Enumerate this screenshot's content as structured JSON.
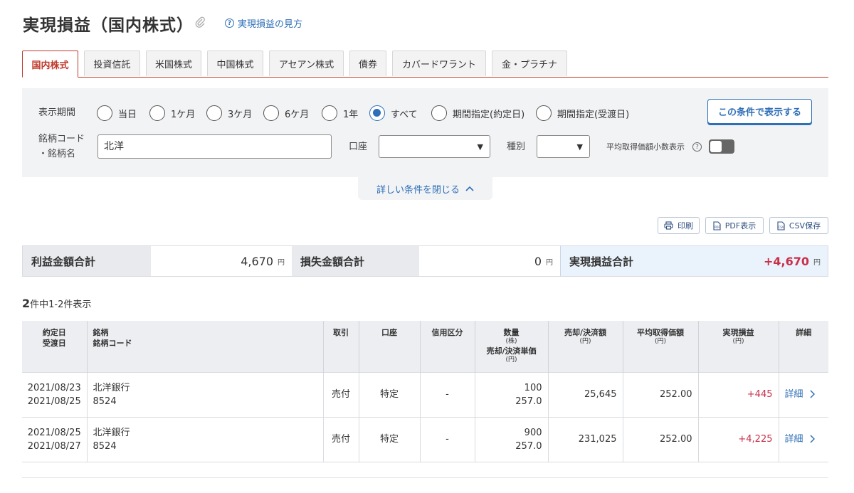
{
  "header": {
    "title": "実現損益（国内株式）",
    "help_link": "実現損益の見方"
  },
  "tabs": [
    {
      "label": "国内株式",
      "active": true
    },
    {
      "label": "投資信託",
      "active": false
    },
    {
      "label": "米国株式",
      "active": false
    },
    {
      "label": "中国株式",
      "active": false
    },
    {
      "label": "アセアン株式",
      "active": false
    },
    {
      "label": "債券",
      "active": false
    },
    {
      "label": "カバードワラント",
      "active": false
    },
    {
      "label": "金・プラチナ",
      "active": false
    }
  ],
  "filter": {
    "period_label": "表示期間",
    "period_options": [
      {
        "label": "当日",
        "checked": false
      },
      {
        "label": "1ケ月",
        "checked": false
      },
      {
        "label": "3ケ月",
        "checked": false
      },
      {
        "label": "6ケ月",
        "checked": false
      },
      {
        "label": "1年",
        "checked": false
      },
      {
        "label": "すべて",
        "checked": true
      },
      {
        "label": "期間指定(約定日)",
        "checked": false
      },
      {
        "label": "期間指定(受渡日)",
        "checked": false
      }
    ],
    "submit_label": "この条件で表示する",
    "code_label_line1": "銘柄コード",
    "code_label_line2": "・銘柄名",
    "code_value": "北洋",
    "account_label": "口座",
    "account_value": "",
    "type_label": "種別",
    "type_value": "",
    "decimal_label": "平均取得価額小数表示",
    "decimal_toggle": false,
    "collapse_label": "詳しい条件を閉じる"
  },
  "actions": {
    "print": "印刷",
    "pdf": "PDF表示",
    "csv": "CSV保存"
  },
  "summary": {
    "profit_label": "利益金額合計",
    "profit_value": "4,670",
    "loss_label": "損失金額合計",
    "loss_value": "0",
    "total_label": "実現損益合計",
    "total_value": "+4,670",
    "unit": "円"
  },
  "count": {
    "total": "2",
    "text": "件中1-2件表示"
  },
  "table": {
    "headers": {
      "date1": "約定日",
      "date2": "受渡日",
      "stock1": "銘柄",
      "stock2": "銘柄コード",
      "trade": "取引",
      "account": "口座",
      "credit": "信用区分",
      "qty": "数量",
      "qty_unit": "(株)",
      "unit_price": "売却/決済単価",
      "unit_price_unit": "(円)",
      "amount": "売却/決済額",
      "amount_unit": "(円)",
      "avg": "平均取得価額",
      "avg_unit": "(円)",
      "pl": "実現損益",
      "pl_unit": "(円)",
      "detail": "詳細"
    },
    "rows": [
      {
        "trade_date": "2021/08/23",
        "settle_date": "2021/08/25",
        "name": "北洋銀行",
        "code": "8524",
        "trade": "売付",
        "account": "特定",
        "credit": "-",
        "qty": "100",
        "price": "257.0",
        "amount": "25,645",
        "avg": "252.00",
        "pl": "+445",
        "detail": "詳細"
      },
      {
        "trade_date": "2021/08/25",
        "settle_date": "2021/08/27",
        "name": "北洋銀行",
        "code": "8524",
        "trade": "売付",
        "account": "特定",
        "credit": "-",
        "qty": "900",
        "price": "257.0",
        "amount": "231,025",
        "avg": "252.00",
        "pl": "+4,225",
        "detail": "詳細"
      }
    ]
  },
  "colors": {
    "accent": "#c0392b",
    "link": "#2f6fb7",
    "profit": "#c8304a"
  }
}
